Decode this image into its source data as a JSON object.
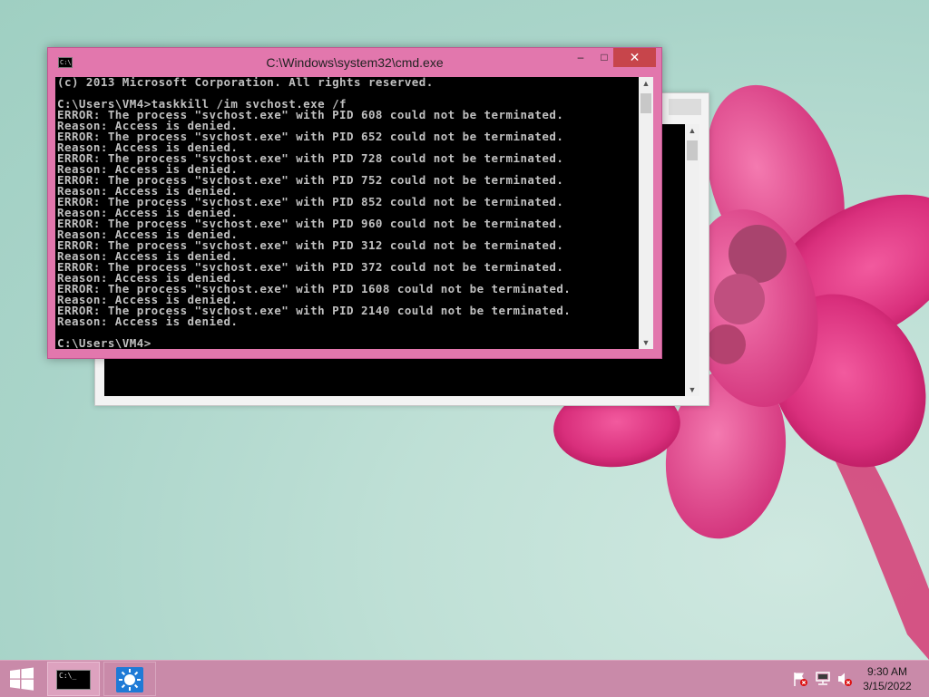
{
  "cmd_window": {
    "title": "C:\\Windows\\system32\\cmd.exe",
    "icon_label": "C:\\",
    "minimize_label": "–",
    "maximize_label": "□",
    "close_label": "✕",
    "console_lines": [
      "(c) 2013 Microsoft Corporation. All rights reserved.",
      "",
      "C:\\Users\\VM4>taskkill /im svchost.exe /f",
      "ERROR: The process \"svchost.exe\" with PID 608 could not be terminated.",
      "Reason: Access is denied.",
      "ERROR: The process \"svchost.exe\" with PID 652 could not be terminated.",
      "Reason: Access is denied.",
      "ERROR: The process \"svchost.exe\" with PID 728 could not be terminated.",
      "Reason: Access is denied.",
      "ERROR: The process \"svchost.exe\" with PID 752 could not be terminated.",
      "Reason: Access is denied.",
      "ERROR: The process \"svchost.exe\" with PID 852 could not be terminated.",
      "Reason: Access is denied.",
      "ERROR: The process \"svchost.exe\" with PID 960 could not be terminated.",
      "Reason: Access is denied.",
      "ERROR: The process \"svchost.exe\" with PID 312 could not be terminated.",
      "Reason: Access is denied.",
      "ERROR: The process \"svchost.exe\" with PID 372 could not be terminated.",
      "Reason: Access is denied.",
      "ERROR: The process \"svchost.exe\" with PID 1608 could not be terminated.",
      "Reason: Access is denied.",
      "ERROR: The process \"svchost.exe\" with PID 2140 could not be terminated.",
      "Reason: Access is denied.",
      "",
      "C:\\Users\\VM4>"
    ]
  },
  "taskbar": {
    "cmd_icon_label": "C:\\_",
    "clock_time": "9:30 AM",
    "clock_date": "3/15/2022",
    "tray_icons": [
      "flag-icon",
      "network-icon",
      "volume-muted-icon"
    ]
  },
  "colors": {
    "title_bar": "#e277ad",
    "close_button": "#c7454b",
    "taskbar": "#c98aa9",
    "console_text": "#c0c0c0",
    "console_bg": "#000000"
  }
}
